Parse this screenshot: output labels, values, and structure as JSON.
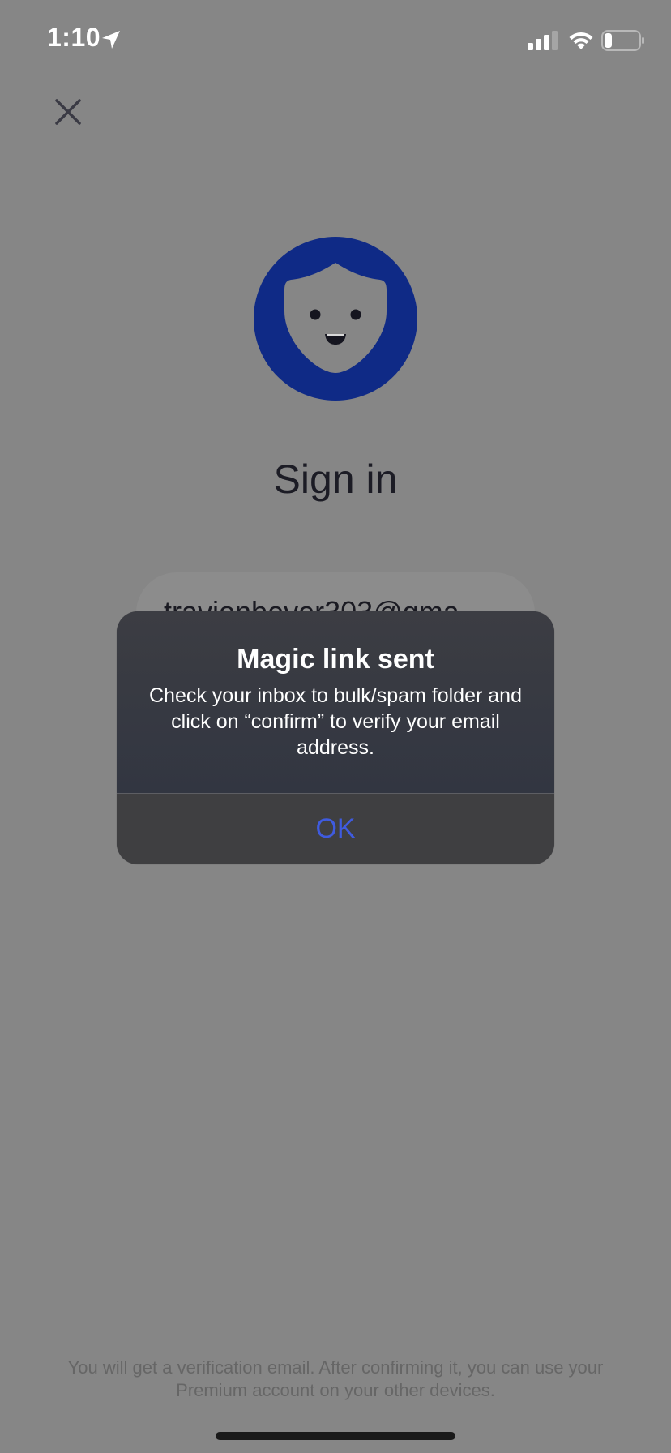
{
  "status_bar": {
    "time": "1:10",
    "icons": [
      "location-arrow-icon",
      "cellular-signal-icon",
      "wifi-icon",
      "battery-icon"
    ]
  },
  "header": {
    "close_icon": "close-icon"
  },
  "logo": {
    "icon": "mascot-face-logo",
    "color": "#0f2a86"
  },
  "page": {
    "title": "Sign in",
    "email_value": "travionbeyer303@gma",
    "footer_note": "You will get a verification email. After confirming it, you can use your Premium account on your other devices."
  },
  "alert": {
    "title": "Magic link sent",
    "message": "Check your inbox to bulk/spam folder and click on “confirm” to verify your email address.",
    "ok_label": "OK",
    "ok_color": "#3f5bdf"
  }
}
